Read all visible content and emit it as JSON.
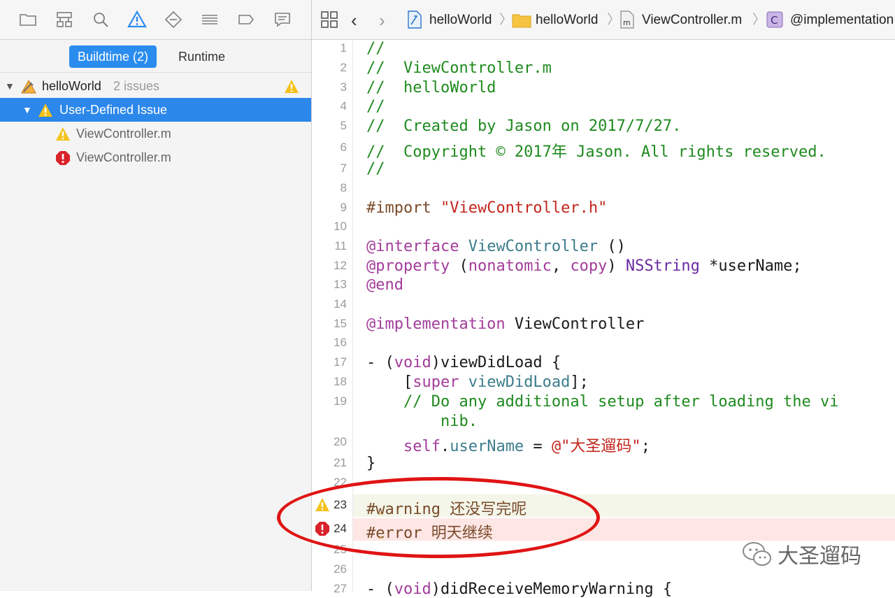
{
  "navigator": {
    "icons": [
      "folder-icon",
      "hierarchy-icon",
      "search-icon",
      "warning-navigator-icon",
      "test-diamond-icon",
      "debug-list-icon",
      "breakpoint-icon",
      "report-icon"
    ],
    "tabs": [
      {
        "label": "Buildtime (2)",
        "active": true
      },
      {
        "label": "Runtime",
        "active": false
      }
    ],
    "tree": {
      "project": {
        "name": "helloWorld",
        "issues": "2 issues"
      },
      "group": "User-Defined Issue",
      "items": [
        {
          "type": "warning",
          "label": "ViewController.m"
        },
        {
          "type": "error",
          "label": "ViewController.m"
        }
      ]
    }
  },
  "jumpbar": {
    "crumbs": [
      "helloWorld",
      "helloWorld",
      "ViewController.m",
      "@implementation"
    ]
  },
  "editor": {
    "lines": [
      {
        "n": "1",
        "t": "//"
      },
      {
        "n": "2",
        "t": "//  ViewController.m"
      },
      {
        "n": "3",
        "t": "//  helloWorld"
      },
      {
        "n": "4",
        "t": "//"
      },
      {
        "n": "5",
        "t": "//  Created by Jason on 2017/7/27."
      },
      {
        "n": "6",
        "t": "//  Copyright © 2017年 Jason. All rights reserved."
      },
      {
        "n": "7",
        "t": "//"
      },
      {
        "n": "8",
        "t": ""
      },
      {
        "n": "9",
        "t": "#import \"ViewController.h\""
      },
      {
        "n": "10",
        "t": ""
      },
      {
        "n": "11",
        "t": "@interface ViewController ()"
      },
      {
        "n": "12",
        "t": "@property (nonatomic, copy) NSString *userName;"
      },
      {
        "n": "13",
        "t": "@end"
      },
      {
        "n": "14",
        "t": ""
      },
      {
        "n": "15",
        "t": "@implementation ViewController"
      },
      {
        "n": "16",
        "t": ""
      },
      {
        "n": "17",
        "t": "- (void)viewDidLoad {"
      },
      {
        "n": "18",
        "t": "    [super viewDidLoad];"
      },
      {
        "n": "19",
        "t": "    // Do any additional setup after loading the vi"
      },
      {
        "n": "",
        "t": "        nib."
      },
      {
        "n": "20",
        "t": "    self.userName = @\"大圣遛码\";"
      },
      {
        "n": "21",
        "t": "}"
      },
      {
        "n": "22",
        "t": ""
      },
      {
        "n": "23",
        "t": "#warning 还没写完呢"
      },
      {
        "n": "24",
        "t": "#error 明天继续"
      },
      {
        "n": "25",
        "t": ""
      },
      {
        "n": "26",
        "t": ""
      },
      {
        "n": "27",
        "t": "- (void)didReceiveMemoryWarning {"
      }
    ]
  },
  "watermark": "大圣遛码",
  "colors": {
    "selection": "#2b87ea",
    "warning": "#f4c21b",
    "error": "#d9232a",
    "annotation": "#e01414"
  }
}
